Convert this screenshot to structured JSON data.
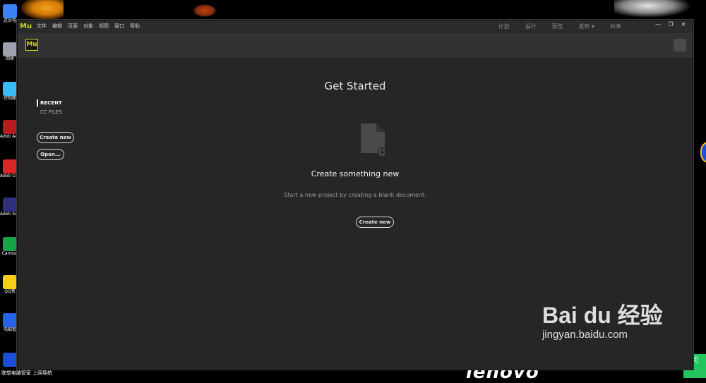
{
  "desktop": {
    "icons": [
      {
        "label": "这台电",
        "color": "#3b82f6"
      },
      {
        "label": "回收",
        "color": "#9ca3af"
      },
      {
        "label": "控制面",
        "color": "#38bdf8"
      },
      {
        "label": "Adob Acroba",
        "color": "#b91c1c"
      },
      {
        "label": "Adob Creat",
        "color": "#dc2626"
      },
      {
        "label": "Adob Scout",
        "color": "#312e81"
      },
      {
        "label": "Camtas",
        "color": "#16a34a"
      },
      {
        "label": "QQ音",
        "color": "#facc15"
      },
      {
        "label": "电脑管",
        "color": "#2563eb"
      },
      {
        "label": "",
        "color": "#1d4ed8"
      }
    ],
    "taskbar": [
      "联想电脑管家",
      "上网导航"
    ],
    "brand": "lenovo",
    "corner_badge": "问",
    "watermark": {
      "main": "Bai du 经验",
      "url": "jingyan.baidu.com"
    }
  },
  "app": {
    "logo_text": "Mu",
    "menu": [
      "文件",
      "编辑",
      "页面",
      "对象",
      "视图",
      "窗口",
      "帮助"
    ],
    "workspace_modes": [
      "计划",
      "设计",
      "预览",
      "发布 ▾",
      "共享"
    ],
    "window_controls": [
      "—",
      "❐",
      "✕"
    ],
    "left_nav": {
      "recent": "RECENT",
      "cc_files": "CC FILES",
      "create_new": "Create new",
      "open": "Open..."
    },
    "main": {
      "title": "Get Started",
      "sub_title": "Create something new",
      "description": "Start a new project by creating a blank document.",
      "create_button": "Create new"
    },
    "accent_color": "#c8d42a"
  }
}
